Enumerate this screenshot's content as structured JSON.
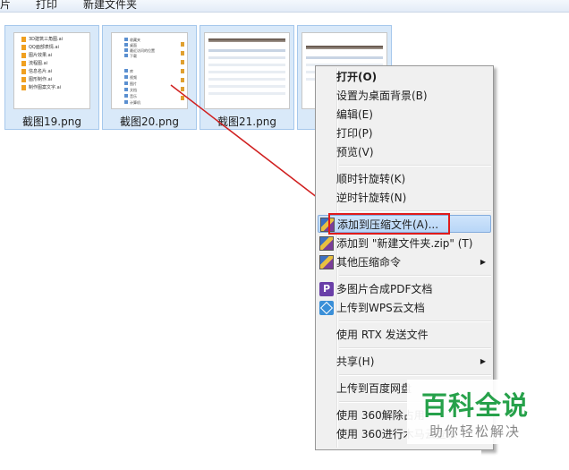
{
  "toolbar": {
    "item_partial": "片",
    "print": "打印",
    "new_folder": "新建文件夹"
  },
  "thumbnails": [
    {
      "caption": "截图19.png",
      "files": [
        "3D建筑三角图.ai",
        "QQ面部表情.ai",
        "图片效果.ai",
        "流程图.ai",
        "信息名片.ai",
        "图形制作.ai",
        "制作图案文字.ai"
      ]
    },
    {
      "caption": "截图20.png",
      "tree": [
        "收藏夹",
        "桌面",
        "最近访问的位置",
        "下载",
        "库",
        "视频",
        "图片",
        "文档",
        "音乐",
        "计算机"
      ]
    },
    {
      "caption": "截图21.png"
    },
    {
      "caption": ""
    }
  ],
  "context_menu": {
    "items": [
      {
        "label": "打开(O)",
        "bold": true
      },
      {
        "label": "设置为桌面背景(B)"
      },
      {
        "label": "编辑(E)"
      },
      {
        "label": "打印(P)"
      },
      {
        "label": "预览(V)"
      },
      {
        "label": "顺时针旋转(K)"
      },
      {
        "label": "逆时针旋转(N)"
      },
      {
        "label": "添加到压缩文件(A)...",
        "icon": "winrar-icon"
      },
      {
        "label": "添加到 \"新建文件夹.zip\" (T)",
        "icon": "winrar-icon"
      },
      {
        "label": "其他压缩命令",
        "icon": "winrar-icon",
        "submenu": true
      },
      {
        "label": "多图片合成PDF文档",
        "icon": "pdf-icon"
      },
      {
        "label": "上传到WPS云文档",
        "icon": "wps-cloud-icon"
      },
      {
        "label": "使用 RTX 发送文件"
      },
      {
        "label": "共享(H)",
        "submenu": true
      },
      {
        "label": "上传到百度网盘"
      },
      {
        "label": "使用 360解除占用"
      },
      {
        "label": "使用 360进行木马云查杀"
      }
    ]
  },
  "watermark": {
    "title": "百科全说",
    "subtitle": "助你轻松解决"
  },
  "colors": {
    "highlight_box": "#e01b1b",
    "arrow": "#d02020",
    "watermark_green": "#26a14a"
  }
}
